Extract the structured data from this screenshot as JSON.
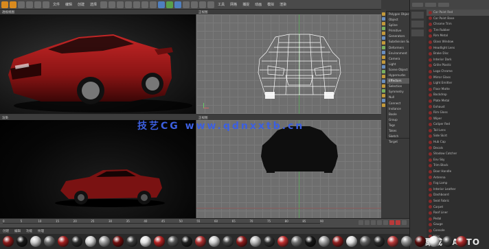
{
  "toolbar": {
    "menus": [
      "文件",
      "编辑",
      "创建",
      "选择",
      "工具",
      "网格",
      "捕捉",
      "动画",
      "模拟",
      "渲染"
    ]
  },
  "viewports": {
    "perspective": {
      "label": "透视视图"
    },
    "top": {
      "label": "正视图"
    },
    "render": {
      "label": "渲染"
    },
    "front": {
      "label": "正视图"
    }
  },
  "watermark": "技艺CG www.qdnxxtb.cn",
  "menu": {
    "items": [
      "Polygon Object",
      "Object",
      "Spline",
      "Primitive",
      "Generators",
      "Subdivision Surface",
      "Deformers",
      "Environment",
      "Camera",
      "Light",
      "Scene Object",
      "Hypernurbs",
      "Effectors",
      "Selection",
      "Symmetry",
      "Null",
      "Connect",
      "Instance",
      "Boole",
      "Group",
      "Tags",
      "Takes",
      "Sketch",
      "Target"
    ],
    "selected_index": 12
  },
  "materials_panel": {
    "items": [
      "Car Paint Red",
      "Car Paint Base",
      "Chrome Trim",
      "Tire Rubber",
      "Rim Metal",
      "Glass Window",
      "Headlight Lens",
      "Brake Disc",
      "Interior Dark",
      "Grille Plastic",
      "Logo Chrome",
      "Mirror Glass",
      "Light Emitter",
      "Floor Matte",
      "Backdrop",
      "Plate Metal",
      "Exhaust",
      "Rim Gloss",
      "Wiper",
      "Caliper Red",
      "Tail Lens",
      "Side Skirt",
      "Hub Cap",
      "Decals",
      "Shadow Catcher",
      "Env Sky",
      "Trim Black",
      "Door Handle",
      "Antenna",
      "Fog Lamp",
      "Interior Leather",
      "Dashboard",
      "Seat Fabric",
      "Carpet",
      "Roof Liner",
      "Pedal",
      "Gauge",
      "Console",
      "Misc"
    ],
    "selected_index": 0,
    "logo": "聚成　AUTO"
  },
  "timeline": {
    "ticks": [
      "0",
      "5",
      "10",
      "15",
      "20",
      "25",
      "30",
      "35",
      "40",
      "45",
      "50",
      "55",
      "60",
      "65",
      "70",
      "75",
      "80",
      "85",
      "90"
    ]
  },
  "material_strip": {
    "tabs": [
      "创建",
      "编辑",
      "功能",
      "纹理"
    ],
    "swatch_colors": [
      "#8a1a1a",
      "#1a1a1a",
      "#c8c8c8",
      "#6a6a6a",
      "#a52020",
      "#2a2a2a",
      "#d0d0d0",
      "#9a9a9a",
      "#701010",
      "#3a3a3a",
      "#e0e0e0",
      "#b22222",
      "#555555",
      "#202020",
      "#aa3030",
      "#cccccc",
      "#444444",
      "#8c1c1c",
      "#bababa",
      "#303030",
      "#c03030",
      "#707070",
      "#181818",
      "#a0a0a0",
      "#902020",
      "#dcdcdc",
      "#606060",
      "#2c2c2c",
      "#b83a3a",
      "#8e8e8e",
      "#5a1010",
      "#e8e8e8",
      "#3e3e3e",
      "#a82828"
    ]
  },
  "colors": {
    "watermark": "#3c5fe0",
    "car_paint": "#9a1818",
    "wireframe": "#ffffff",
    "accent_orange": "#d98a1e"
  }
}
